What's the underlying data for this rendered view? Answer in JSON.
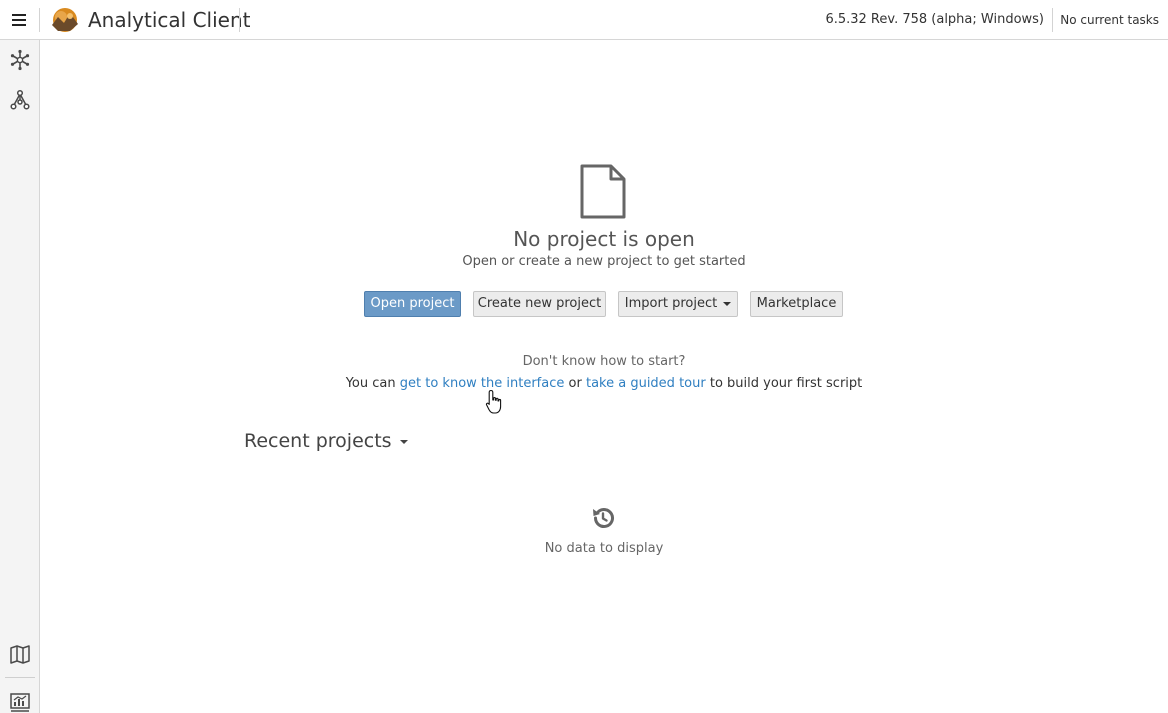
{
  "header": {
    "app_title": "Analytical Client",
    "version": "6.5.32 Rev. 758 (alpha; Windows)",
    "tasks": "No current tasks"
  },
  "empty_state": {
    "title": "No project is open",
    "subtitle": "Open or create a new project to get started",
    "buttons": {
      "open": "Open project",
      "create": "Create new project",
      "import": "Import project",
      "marketplace": "Marketplace"
    },
    "help_question": "Don't know how to start?",
    "help_prefix": "You can",
    "help_link_interface": "get to know the interface",
    "help_or": "or",
    "help_link_tour": "take a guided tour",
    "help_suffix": "to build your first script"
  },
  "recent": {
    "title": "Recent projects",
    "empty_text": "No data to display"
  },
  "icons": {
    "menu": "hamburger-menu-icon",
    "logo": "app-logo-icon",
    "sidebar": [
      "snowflake-icon",
      "network-nodes-icon",
      "map-icon",
      "chart-monitor-icon"
    ],
    "document": "document-icon",
    "history": "history-icon"
  },
  "colors": {
    "primary_button": "#6b9ac7",
    "link": "#2f7fc1"
  }
}
